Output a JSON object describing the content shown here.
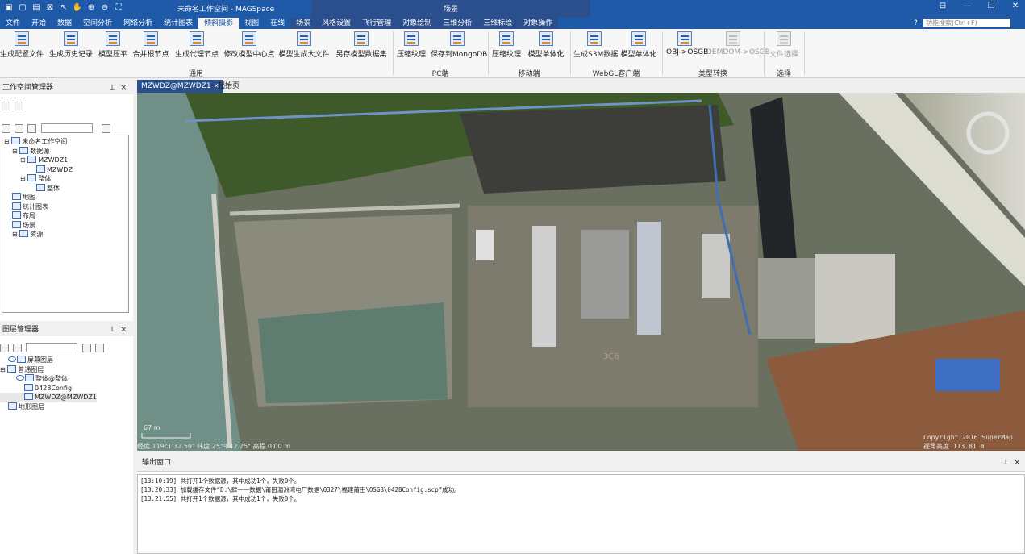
{
  "window": {
    "title": "未命名工作空间 - MAGSpace",
    "context_title": "场景",
    "controls": [
      "⊟",
      "—",
      "❐",
      "✕"
    ]
  },
  "menu": {
    "tabs": [
      "文件",
      "开始",
      "数据",
      "空间分析",
      "网络分析",
      "统计图表",
      "倾斜摄影",
      "视图",
      "在线",
      "场景",
      "风格设置",
      "飞行管理",
      "对象绘制",
      "三维分析",
      "三维标绘",
      "对象操作"
    ],
    "active_tab": "倾斜摄影",
    "search_placeholder": "功能搜索(Ctrl+F)"
  },
  "ribbon": {
    "groups": [
      {
        "label": "通用",
        "buttons": [
          "生成配置文件",
          "生成历史记录",
          "模型压平",
          "合并根节点",
          "生成代理节点",
          "修改模型中心点",
          "模型生成大文件",
          "另存模型数据集"
        ]
      },
      {
        "label": "PC端",
        "buttons": [
          "压缩纹理",
          "保存到MongoDB"
        ]
      },
      {
        "label": "移动端",
        "buttons": [
          "压缩纹理",
          "模型单体化"
        ]
      },
      {
        "label": "WebGL客户端",
        "buttons": [
          "生成S3M数据",
          "模型单体化"
        ]
      },
      {
        "label": "类型转换",
        "buttons": [
          "OBJ->OSGB",
          "DEMDOM->OSGB"
        ]
      },
      {
        "label": "选择",
        "buttons": [
          "文件选择"
        ]
      }
    ]
  },
  "workspace_panel": {
    "title": "工作空间管理器",
    "tree": [
      {
        "label": "未命名工作空间"
      },
      {
        "label": "数据源"
      },
      {
        "label": "MZWDZ1"
      },
      {
        "label": "MZWDZ"
      },
      {
        "label": "整体"
      },
      {
        "label": "整体"
      },
      {
        "label": "地图"
      },
      {
        "label": "统计图表"
      },
      {
        "label": "布局"
      },
      {
        "label": "场景"
      },
      {
        "label": "资源"
      }
    ]
  },
  "layer_panel": {
    "title": "图层管理器",
    "tree": [
      {
        "label": "屏幕图层"
      },
      {
        "label": "普通图层"
      },
      {
        "label": "整体@整体"
      },
      {
        "label": "0428Config"
      },
      {
        "label": "MZWDZ@MZWDZ1"
      },
      {
        "label": "地形图层"
      }
    ]
  },
  "doc_tabs": [
    "MZWDZ@MZWDZ1",
    "起始页"
  ],
  "scene": {
    "status": "经度 119°1'32.59\"  纬度 25°9'42.25\"  高程 0.00 m",
    "copyright": "Copyright 2016 SuperMap",
    "view_alt": "视角高度 113.81 m",
    "scale": "67 m",
    "factory_text": "3C6"
  },
  "output": {
    "title": "输出窗口",
    "lines": [
      "[13:10:19] 共打开1个数据源，其中成功1个，失败0个。",
      "[13:20:33] 加载缓存文件“D:\\肆一一数据\\莆田湄洲湾电厂数据\\0327\\福建莆田\\OSGB\\0428Config.scp”成功。",
      "[13:21:55] 共打开1个数据源，其中成功1个，失败0个。"
    ]
  },
  "colors": {
    "titlebar": "#1e5aa8",
    "context": "#2b4f8c",
    "water": "#6f8f87",
    "vegetation": "#3f5a2a"
  }
}
